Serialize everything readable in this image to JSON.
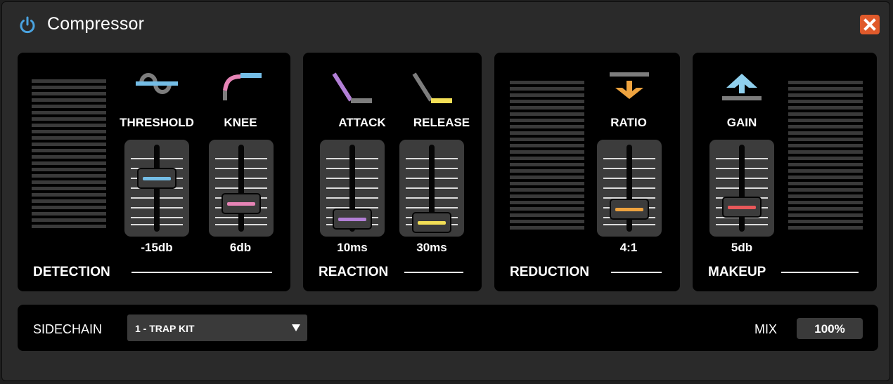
{
  "window": {
    "title": "Compressor"
  },
  "icons": {
    "power": "power-icon",
    "close": "close-icon"
  },
  "sections": {
    "detection": {
      "label": "DETECTION"
    },
    "reaction": {
      "label": "REACTION"
    },
    "reduction": {
      "label": "REDUCTION"
    },
    "makeup": {
      "label": "MAKEUP"
    }
  },
  "controls": {
    "threshold": {
      "label": "THRESHOLD",
      "value": "-15db",
      "level": 0.78,
      "color": "#74bde6",
      "icon": "threshold-icon"
    },
    "knee": {
      "label": "KNEE",
      "value": "6db",
      "level": 0.36,
      "color": "#e684b6",
      "icon": "knee-icon"
    },
    "attack": {
      "label": "ATTACK",
      "value": "10ms",
      "level": 0.1,
      "color": "#b27fd6",
      "icon": "attack-icon"
    },
    "release": {
      "label": "RELEASE",
      "value": "30ms",
      "level": 0.03,
      "color": "#f3df56",
      "icon": "release-icon"
    },
    "ratio": {
      "label": "RATIO",
      "value": "4:1",
      "level": 0.26,
      "color": "#eea33f",
      "icon": "ratio-icon"
    },
    "gain": {
      "label": "GAIN",
      "value": "5db",
      "level": 0.3,
      "color": "#e8585a",
      "icon": "gain-icon"
    }
  },
  "sidechain": {
    "label": "SIDECHAIN",
    "value": "1 - TRAP KIT"
  },
  "mix": {
    "label": "MIX",
    "value": "100%"
  }
}
